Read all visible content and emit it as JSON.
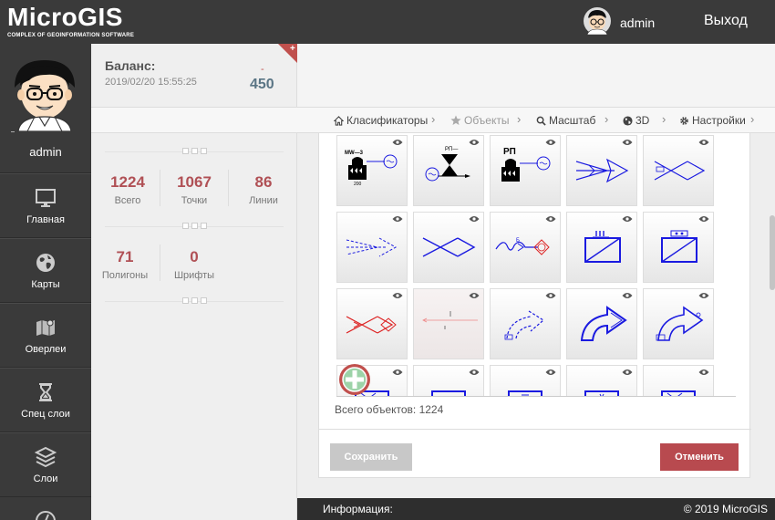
{
  "header": {
    "logo": "MicroGIS",
    "logo_subtitle": "COMPLEX OF GEOINFORMATION SOFTWARE",
    "username": "admin",
    "logout": "Выход"
  },
  "sidebar": {
    "username": "admin",
    "items": [
      {
        "label": "Главная",
        "icon": "monitor-icon"
      },
      {
        "label": "Карты",
        "icon": "globe-icon"
      },
      {
        "label": "Оверлеи",
        "icon": "map-icon"
      },
      {
        "label": "Спец слои",
        "icon": "hourglass-icon"
      },
      {
        "label": "Слои",
        "icon": "layers-icon"
      }
    ]
  },
  "balance": {
    "title": "Баланс:",
    "timestamp": "2019/02/20 15:55:25",
    "delta": "-",
    "value": "450"
  },
  "stats": [
    {
      "value": "1224",
      "label": "Всего"
    },
    {
      "value": "1067",
      "label": "Точки"
    },
    {
      "value": "86",
      "label": "Линии"
    },
    {
      "value": "71",
      "label": "Полигоны"
    },
    {
      "value": "0",
      "label": "Шрифты"
    }
  ],
  "breadcrumb": [
    {
      "label": "Класификаторы",
      "icon": "home-icon"
    },
    {
      "label": "Объекты",
      "icon": "star-icon"
    },
    {
      "label": "Масштаб",
      "icon": "search-icon"
    },
    {
      "label": "3D",
      "icon": "globe-icon"
    },
    {
      "label": "Настройки",
      "icon": "gear-icon"
    }
  ],
  "tiles": {
    "t1_code": "MW—3",
    "t1_num": "200",
    "t2_code": "РП—",
    "t3_code": "РП",
    "t8_code": "Б"
  },
  "panel": {
    "total": "Всего объектов: 1224",
    "save": "Сохранить",
    "cancel": "Отменить"
  },
  "footer": {
    "info": "Информация:",
    "copyright": "© 2019 MicroGIS"
  },
  "colors": {
    "accent_red": "#b84a4f",
    "dark_bg": "#3a3a3a",
    "symbol_blue": "#1a1ae0"
  }
}
